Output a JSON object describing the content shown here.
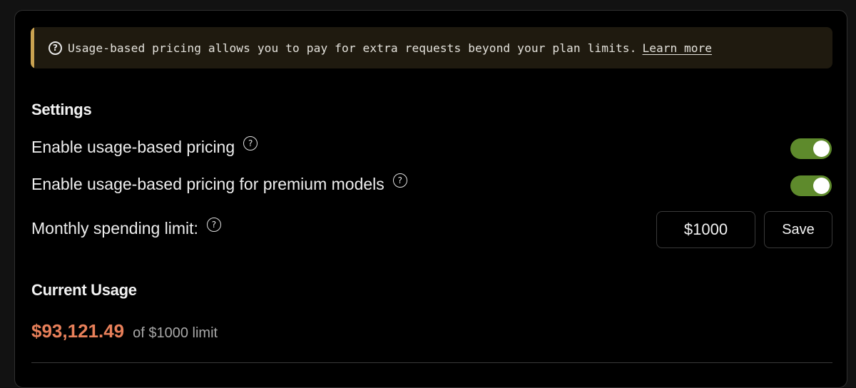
{
  "banner": {
    "icon": "question-circle-icon",
    "text": "Usage-based pricing allows you to pay for extra requests beyond your plan limits.",
    "link_label": "Learn more",
    "accent_color": "#c9a251"
  },
  "settings": {
    "title": "Settings",
    "usage_based_pricing": {
      "label": "Enable usage-based pricing",
      "enabled": true
    },
    "premium_models_pricing": {
      "label": "Enable usage-based pricing for premium models",
      "enabled": true
    },
    "spending_limit": {
      "label": "Monthly spending limit:",
      "value": "$1000",
      "save_label": "Save"
    },
    "toggle_on_color": "#5e8a2c"
  },
  "usage": {
    "title": "Current Usage",
    "amount": "$93,121.49",
    "limit_text": "of $1000 limit",
    "amount_color": "#e8805a"
  }
}
